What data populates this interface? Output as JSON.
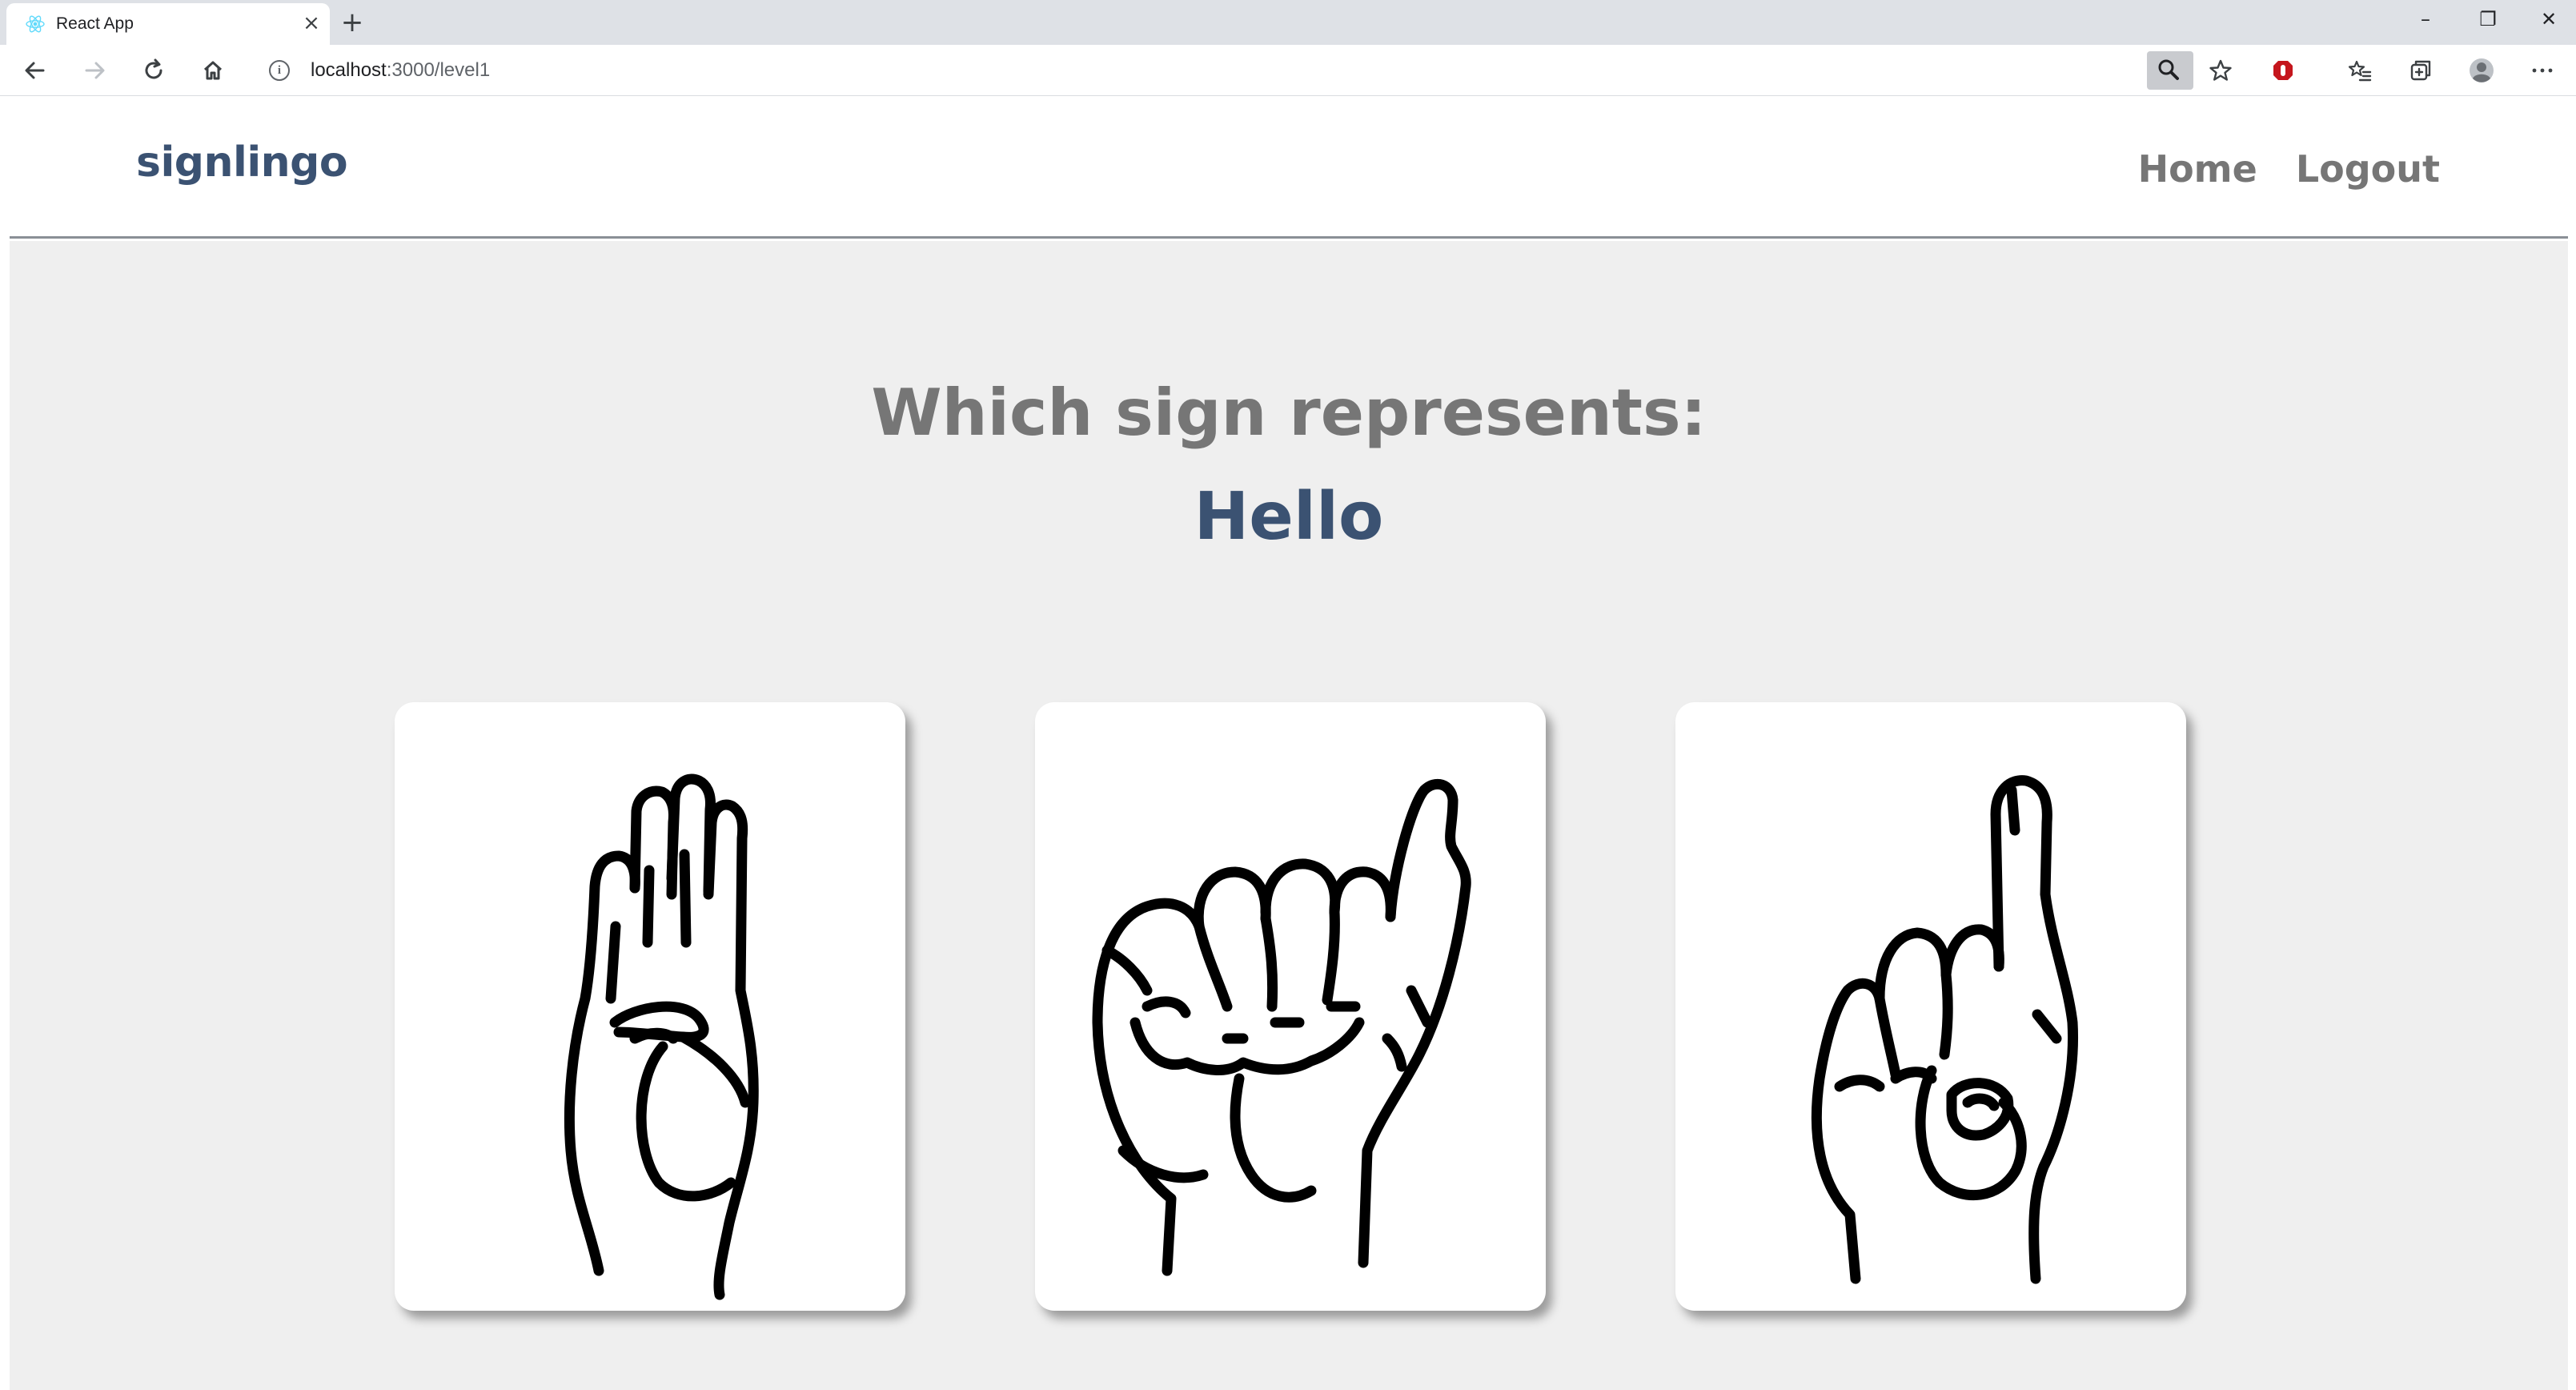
{
  "browser": {
    "tab_title": "React App",
    "tab_close": "×",
    "new_tab": "+",
    "url_host": "localhost",
    "url_path": ":3000/level1",
    "window_controls": {
      "minimize": "–",
      "restore": "❐",
      "close": "✕"
    },
    "icons": [
      "react-favicon-icon",
      "back-icon",
      "forward-icon",
      "reload-icon",
      "home-icon",
      "info-icon",
      "zoom-icon",
      "star-icon",
      "adblock-icon",
      "favorites-icon",
      "collections-icon",
      "profile-icon",
      "more-icon"
    ]
  },
  "navbar": {
    "brand": "signlingo",
    "links": [
      "Home",
      "Logout"
    ]
  },
  "quiz": {
    "question": "Which sign represents:",
    "word": "Hello",
    "options": [
      {
        "icon": "hand-sign-b-icon"
      },
      {
        "icon": "hand-sign-a-icon"
      },
      {
        "icon": "hand-sign-d-icon"
      }
    ]
  },
  "colors": {
    "brand": "#3b5272",
    "muted_text": "#767676",
    "page_background": "#efefef",
    "card_background": "#ffffff"
  }
}
